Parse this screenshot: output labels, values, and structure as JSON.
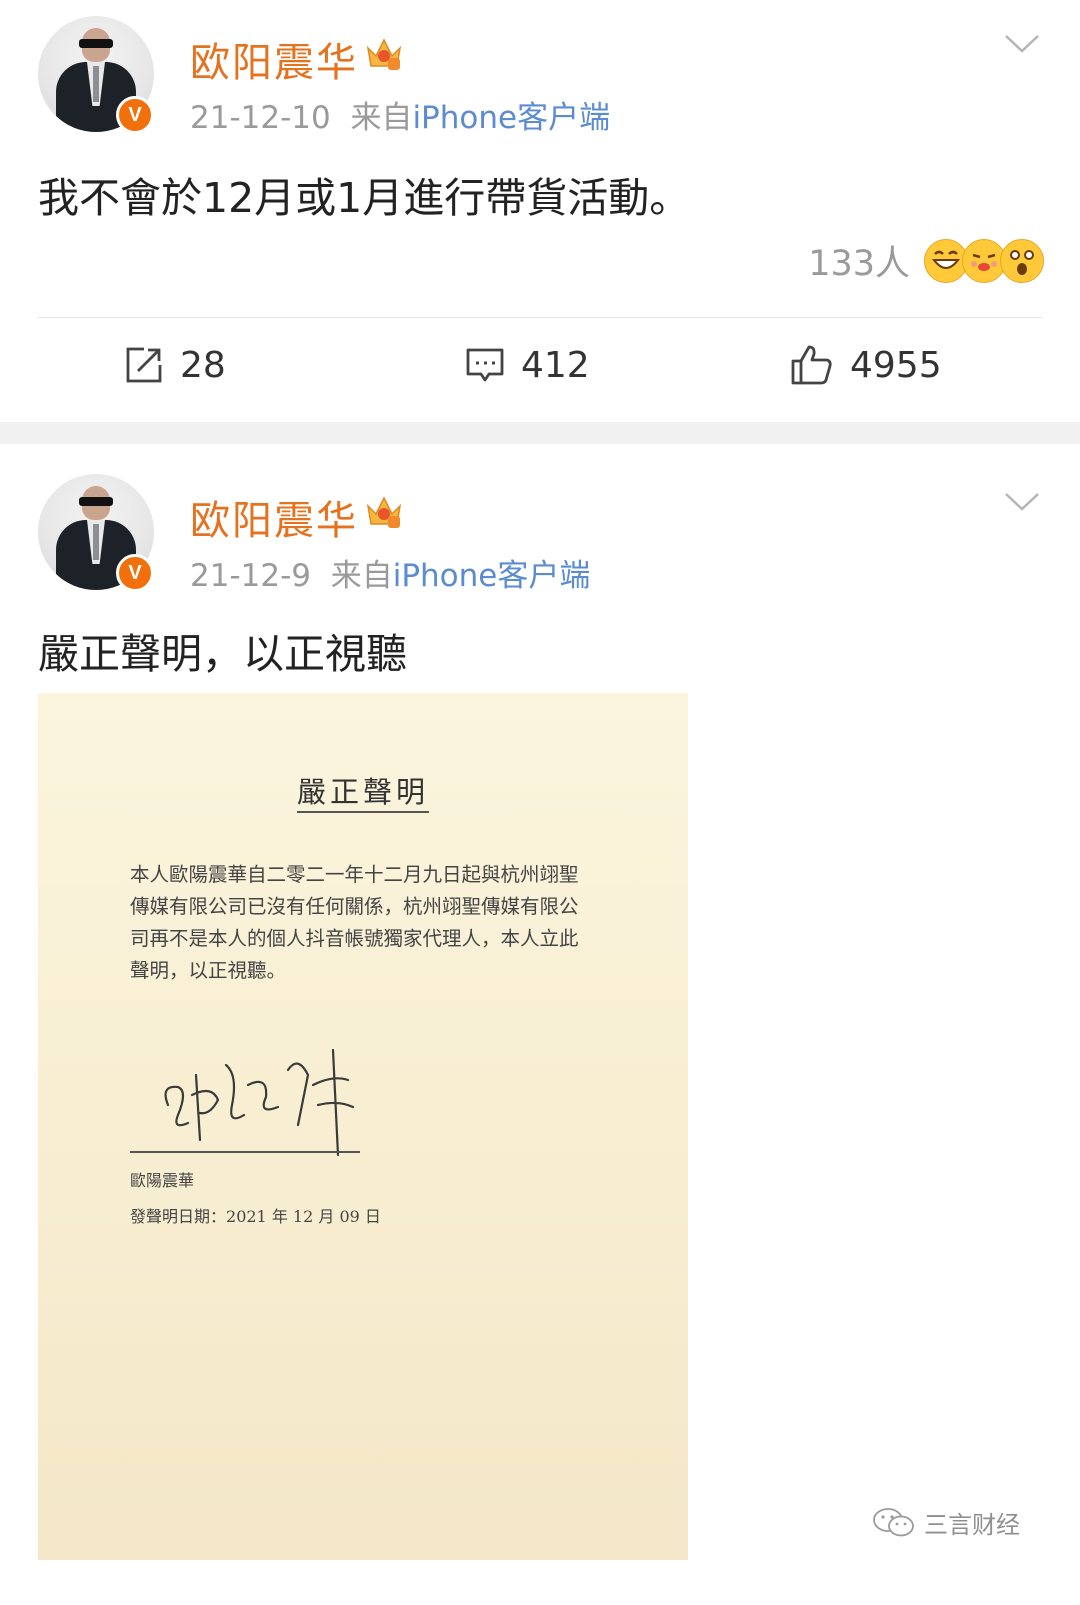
{
  "posts": [
    {
      "username": "欧阳震华",
      "badge": "V",
      "date": "21-12-10",
      "source_prefix": "来自",
      "source": "iPhone客户端",
      "text": "我不會於12月或1月進行帶貨活動。",
      "reaction_count": "133人",
      "reaction_icons": [
        "grinning-emoji",
        "kiss-emoji",
        "shocked-emoji"
      ],
      "actions": {
        "reposts": "28",
        "comments": "412",
        "likes": "4955"
      }
    },
    {
      "username": "欧阳震华",
      "badge": "V",
      "date": "21-12-9",
      "source_prefix": "来自",
      "source": "iPhone客户端",
      "text": "嚴正聲明，以正視聽",
      "statement": {
        "title": "嚴正聲明",
        "body": "本人歐陽震華自二零二一年十二月九日起與杭州翊聖傳媒有限公司已沒有任何關係，杭州翊聖傳媒有限公司再不是本人的個人抖音帳號獨家代理人，本人立此聲明，以正視聽。",
        "signatory": "歐陽震華",
        "date_label": "發聲明日期：",
        "date_value": "2021 年 12 月 09 日"
      }
    }
  ],
  "watermark": {
    "icon": "wechat-icon",
    "text": "三言财经"
  },
  "colors": {
    "username": "#e5721f",
    "source_link": "#5b8bd0",
    "badge": "#f2700b",
    "meta_gray": "#9a9a9a",
    "separator_band": "#f1f1f1",
    "paper": "#f8efd3"
  }
}
